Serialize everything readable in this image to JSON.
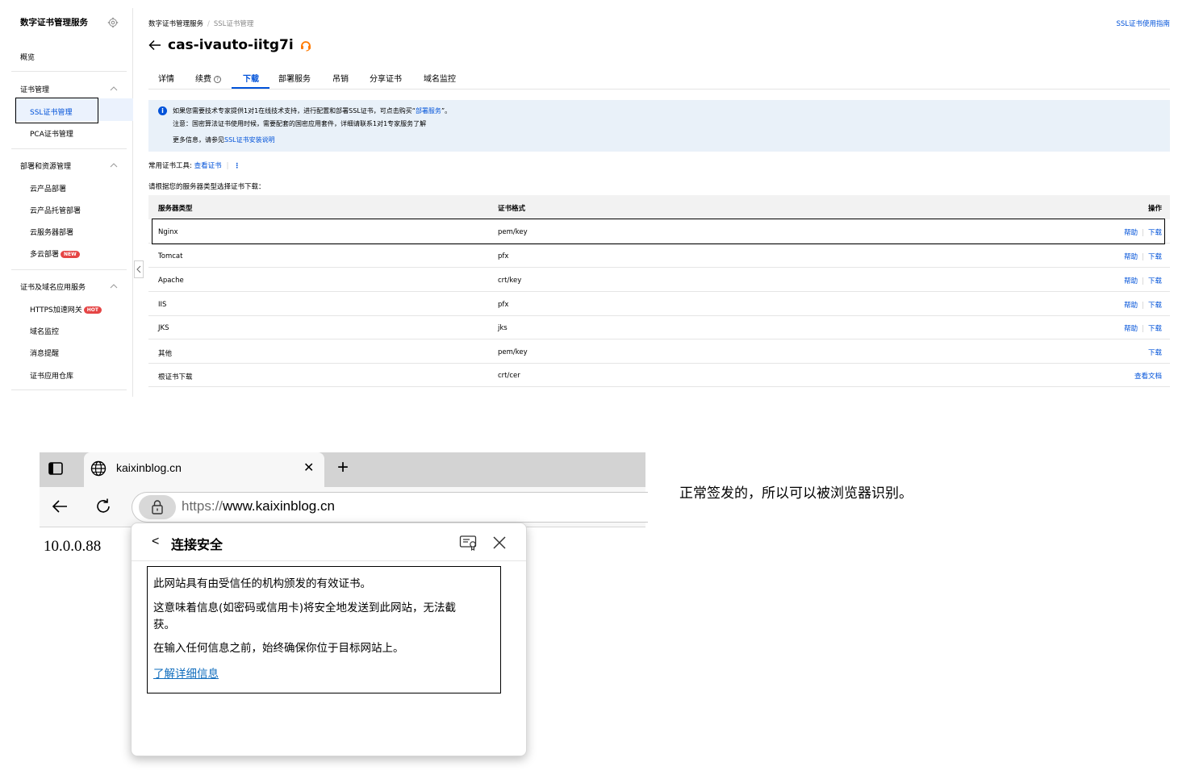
{
  "sidebar": {
    "title": "数字证书管理服务",
    "items": [
      {
        "label": "概览"
      },
      {
        "label": "证书管理"
      },
      {
        "label": "SSL证书管理"
      },
      {
        "label": "PCA证书管理"
      },
      {
        "label": "部署和资源管理"
      },
      {
        "label": "云产品部署"
      },
      {
        "label": "云产品托管部署"
      },
      {
        "label": "云服务器部署"
      },
      {
        "label": "多云部署",
        "badge": "NEW"
      },
      {
        "label": "证书及域名应用服务"
      },
      {
        "label": "HTTPS加速网关",
        "badge": "HOT"
      },
      {
        "label": "域名监控"
      },
      {
        "label": "消息提醒"
      },
      {
        "label": "证书应用仓库"
      }
    ]
  },
  "breadcrumb": {
    "root": "数字证书管理服务",
    "separator": "/",
    "current": "SSL证书管理"
  },
  "guide_link": "SSL证书使用指南",
  "page_title": "cas-ivauto-iitg7i",
  "tabs": [
    "详情",
    "续费",
    "下载",
    "部署服务",
    "吊销",
    "分享证书",
    "域名监控"
  ],
  "tab_renew_help": "?",
  "notice": {
    "line1_prefix": "如果您需要技术专家提供1对1在线技术支持，进行配置和部署SSL证书，可点击购买“",
    "line1_link": "部署服务",
    "line1_suffix": "”。",
    "line2": "注意：国密算法证书使用时候，需要配套的国密应用套件，详细请联系1对1专家服务了解",
    "line3_prefix": "更多信息，请参见",
    "line3_link": "SSL证书安装说明"
  },
  "tools": {
    "label": "常用证书工具:",
    "link": "查看证书"
  },
  "download_hint": "请根据您的服务器类型选择证书下载：",
  "table": {
    "headers": {
      "server": "服务器类型",
      "format": "证书格式",
      "ops": "操作"
    },
    "rows": [
      {
        "server": "Nginx",
        "format": "pem/key",
        "help": "帮助",
        "download": "下载"
      },
      {
        "server": "Tomcat",
        "format": "pfx",
        "help": "帮助",
        "download": "下载"
      },
      {
        "server": "Apache",
        "format": "crt/key",
        "help": "帮助",
        "download": "下载"
      },
      {
        "server": "IIS",
        "format": "pfx",
        "help": "帮助",
        "download": "下载"
      },
      {
        "server": "JKS",
        "format": "jks",
        "help": "帮助",
        "download": "下载"
      },
      {
        "server": "其他",
        "format": "pem/key",
        "download": "下载"
      },
      {
        "server": "根证书下载",
        "format": "crt/cer",
        "docs": "查看文档"
      }
    ]
  },
  "browser": {
    "tab_title": "kaixinblog.cn",
    "url_protocol": "https://",
    "url_host": "www.kaixinblog.cn",
    "page_text": "10.0.0.88",
    "popup": {
      "title": "连接安全",
      "line1": "此网站具有由受信任的机构颁发的有效证书。",
      "line2a": "这意味着信息(如密码或信用卡)将安全地发送到此网站，无法截",
      "line2b": "获。",
      "line3": "在输入任何信息之前，始终确保你位于目标网站上。",
      "link": "了解详细信息"
    }
  },
  "note": "正常签发的，所以可以被浏览器识别。",
  "colors": {
    "accent": "#0052d9",
    "notice_bg": "#e9f1f9",
    "badge_red": "#e54545",
    "edge_link": "#0f6cbd"
  }
}
